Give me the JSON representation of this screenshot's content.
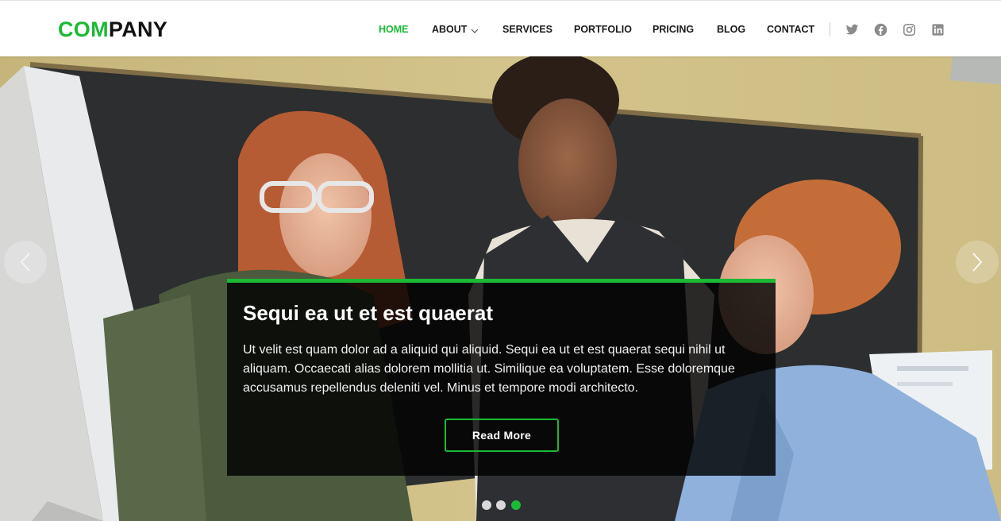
{
  "brand": {
    "logo_accent": "COM",
    "logo_rest": "PANY",
    "accent_color": "#1bb934"
  },
  "nav": {
    "items": [
      {
        "label": "HOME",
        "active": true
      },
      {
        "label": "ABOUT",
        "has_dropdown": true
      },
      {
        "label": "SERVICES"
      },
      {
        "label": "PORTFOLIO"
      },
      {
        "label": "PRICING"
      },
      {
        "label": "BLOG"
      },
      {
        "label": "CONTACT"
      }
    ],
    "social": [
      "twitter-icon",
      "facebook-icon",
      "instagram-icon",
      "linkedin-icon"
    ]
  },
  "hero": {
    "title": "Sequi ea ut et est quaerat",
    "text": "Ut velit est quam dolor ad a aliquid qui aliquid. Sequi ea ut et est quaerat sequi nihil ut aliquam. Occaecati alias dolorem mollitia ut. Similique ea voluptatem. Esse doloremque accusamus repellendus deleniti vel. Minus et tempore modi architecto.",
    "button_label": "Read More",
    "prev_icon": "chevron-left-icon",
    "next_icon": "chevron-right-icon",
    "slide_count": 3,
    "active_slide": 3
  }
}
